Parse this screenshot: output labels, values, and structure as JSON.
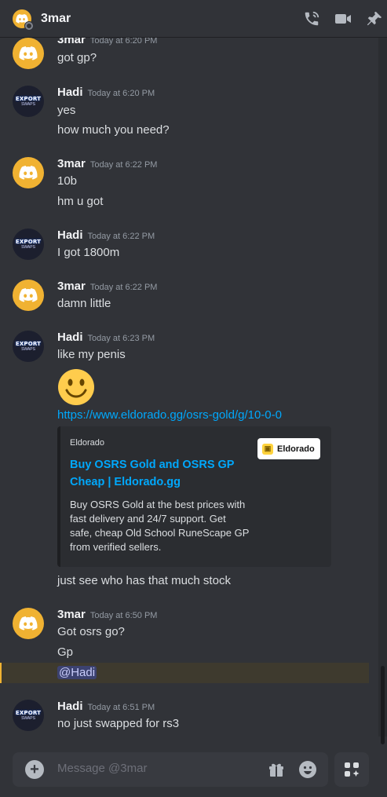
{
  "header": {
    "channel_name": "3mar"
  },
  "messages": [
    {
      "author": "3mar",
      "time": "Today at 6:20 PM",
      "lines": [
        "got gp?"
      ]
    },
    {
      "author": "Hadi",
      "time": "Today at 6:20 PM",
      "lines": [
        "yes",
        "how much you need?"
      ]
    },
    {
      "author": "3mar",
      "time": "Today at 6:22 PM",
      "lines": [
        "10b",
        "hm u got"
      ]
    },
    {
      "author": "Hadi",
      "time": "Today at 6:22 PM",
      "lines": [
        "I got 1800m"
      ]
    },
    {
      "author": "3mar",
      "time": "Today at 6:22 PM",
      "lines": [
        "damn little"
      ]
    },
    {
      "author": "Hadi",
      "time": "Today at 6:23 PM",
      "lines": [
        "like my penis",
        "https://www.eldorado.gg/osrs-gold/g/10-0-0",
        "just see who has that much stock"
      ]
    },
    {
      "author": "3mar",
      "time": "Today at 6:50 PM",
      "lines": [
        "Got osrs go?",
        "Gp",
        "@Hadi"
      ]
    },
    {
      "author": "Hadi",
      "time": "Today at 6:51 PM",
      "lines": [
        "no just swapped for rs3"
      ]
    }
  ],
  "hadi_avatar": {
    "top": "EXPORT",
    "sub": "SWAPS"
  },
  "embed": {
    "provider": "Eldorado",
    "title": "Buy OSRS Gold and OSRS GP Cheap | Eldorado.gg",
    "description": "Buy OSRS Gold at the best prices with fast delivery and 24/7 support. Get safe, cheap Old School RuneScape GP from verified sellers.",
    "thumbnail_text": "Eldorado"
  },
  "composer": {
    "placeholder": "Message @3mar"
  },
  "colors": {
    "background": "#313338",
    "link": "#00a8fc",
    "brand_yellow": "#f0b232"
  }
}
